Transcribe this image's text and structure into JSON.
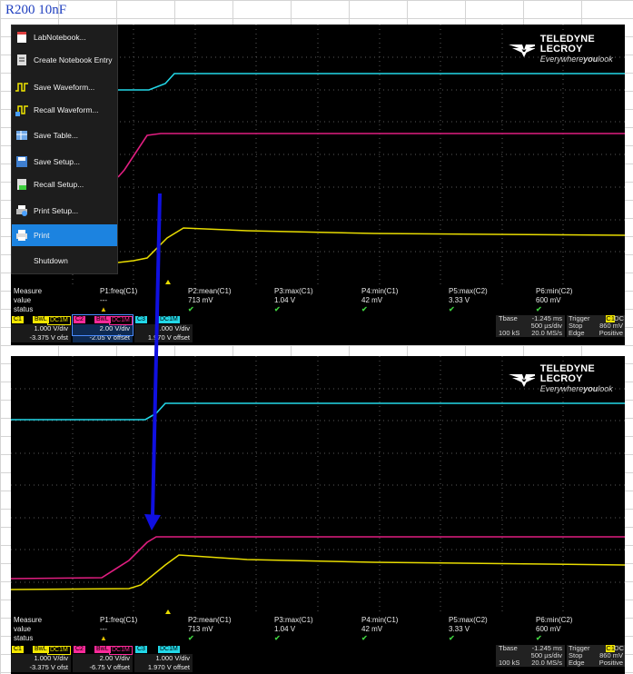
{
  "sheet": {
    "title": "R200 10nF"
  },
  "logo": {
    "brand": "TELEDYNE LECROY",
    "tagline_a": "Everywhere",
    "tagline_b": "you",
    "tagline_c": "look"
  },
  "menu": {
    "items": [
      {
        "label": "LabNotebook...",
        "icon": "notebook-icon"
      },
      {
        "label": "Create Notebook Entry",
        "icon": "notebook-entry-icon"
      },
      {
        "label": "Save Waveform...",
        "icon": "save-waveform-icon"
      },
      {
        "label": "Recall Waveform...",
        "icon": "recall-waveform-icon"
      },
      {
        "label": "Save Table...",
        "icon": "save-table-icon"
      },
      {
        "label": "Save Setup...",
        "icon": "save-setup-icon"
      },
      {
        "label": "Recall Setup...",
        "icon": "recall-setup-icon"
      },
      {
        "label": "Print Setup...",
        "icon": "print-setup-icon"
      },
      {
        "label": "Print",
        "icon": "print-icon",
        "selected": true
      },
      {
        "label": "Shutdown",
        "icon": ""
      }
    ]
  },
  "top": {
    "measure": {
      "headers": [
        "Measure",
        "P1:freq(C1)",
        "P2:mean(C1)",
        "P3:max(C1)",
        "P4:min(C1)",
        "P5:max(C2)",
        "P6:min(C2)"
      ],
      "values": [
        "value",
        "---",
        "713 mV",
        "1.04 V",
        "42 mV",
        "3.33 V",
        "600 mV"
      ],
      "status_label": "status"
    },
    "channels": [
      {
        "name": "C1",
        "bw": "BwL",
        "cpl": "DC1M",
        "vdiv": "1.000 V/div",
        "ofst": "-3.375 V ofst",
        "color": "#f2e600"
      },
      {
        "name": "C2",
        "bw": "BwL",
        "cpl": "DC1M",
        "vdiv": "2.00 V/div",
        "ofst": "-2.05 V offset",
        "color": "#ff2a9a"
      },
      {
        "name": "C3",
        "bw": "",
        "cpl": "DC1M",
        "vdiv": ".000 V/div",
        "ofst": "1.970 V offset",
        "color": "#22d8e8"
      }
    ],
    "tbase": {
      "label": "Tbase",
      "delay": "-1.245 ms",
      "tdiv": "500 µs/div",
      "samples": "100 kS",
      "rate": "20.0 MS/s"
    },
    "trigger": {
      "label": "Trigger",
      "src": "C1",
      "cpl": "DC",
      "mode": "Stop",
      "level": "860 mV",
      "type": "Edge",
      "slope": "Positive"
    }
  },
  "bottom": {
    "measure": {
      "headers": [
        "Measure",
        "P1:freq(C1)",
        "P2:mean(C1)",
        "P3:max(C1)",
        "P4:min(C1)",
        "P5:max(C2)",
        "P6:min(C2)"
      ],
      "values": [
        "value",
        "---",
        "713 mV",
        "1.04 V",
        "42 mV",
        "3.33 V",
        "600 mV"
      ],
      "status_label": "status"
    },
    "channels": [
      {
        "name": "C1",
        "bw": "BwL",
        "cpl": "DC1M",
        "vdiv": "1.000 V/div",
        "ofst": "-3.375 V ofst",
        "color": "#f2e600"
      },
      {
        "name": "C2",
        "bw": "BwL",
        "cpl": "DC1M",
        "vdiv": "2.00 V/div",
        "ofst": "-6.75 V offset",
        "color": "#ff2a9a"
      },
      {
        "name": "C3",
        "bw": "",
        "cpl": "DC1M",
        "vdiv": "1.000 V/div",
        "ofst": "1.970 V offset",
        "color": "#22d8e8"
      }
    ],
    "tbase": {
      "label": "Tbase",
      "delay": "-1.245 ms",
      "tdiv": "500 µs/div",
      "samples": "100 kS",
      "rate": "20.0 MS/s"
    },
    "trigger": {
      "label": "Trigger",
      "src": "C1",
      "cpl": "DC",
      "mode": "Stop",
      "level": "860 mV",
      "type": "Edge",
      "slope": "Positive"
    }
  },
  "colors": {
    "c1": "#f2e600",
    "c2": "#ff2a9a",
    "c3": "#22d8e8",
    "arrow": "#1010e0",
    "check": "#3ecf3e"
  }
}
